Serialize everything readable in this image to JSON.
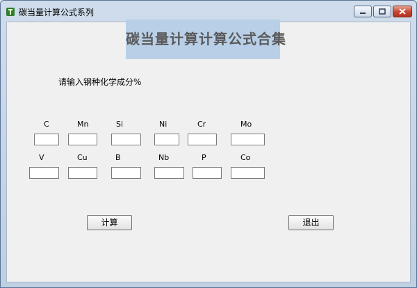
{
  "window": {
    "title": "碳当量计算公式系列"
  },
  "banner": {
    "title": "碳当量计算计算公式合集"
  },
  "prompt": "请输入钢种化学成分%",
  "elements_row1": [
    {
      "label": "C",
      "value": ""
    },
    {
      "label": "Mn",
      "value": ""
    },
    {
      "label": "Si",
      "value": ""
    },
    {
      "label": "Ni",
      "value": ""
    },
    {
      "label": "Cr",
      "value": ""
    },
    {
      "label": "Mo",
      "value": ""
    }
  ],
  "elements_row2": [
    {
      "label": "V",
      "value": ""
    },
    {
      "label": "Cu",
      "value": ""
    },
    {
      "label": "B",
      "value": ""
    },
    {
      "label": "Nb",
      "value": ""
    },
    {
      "label": "P",
      "value": ""
    },
    {
      "label": "Co",
      "value": ""
    }
  ],
  "buttons": {
    "calculate": "计算",
    "exit": "退出"
  },
  "colors": {
    "banner_bg": "#b9cfe8",
    "title_text": "#5a5a5a",
    "close_button": "#c4432e"
  }
}
